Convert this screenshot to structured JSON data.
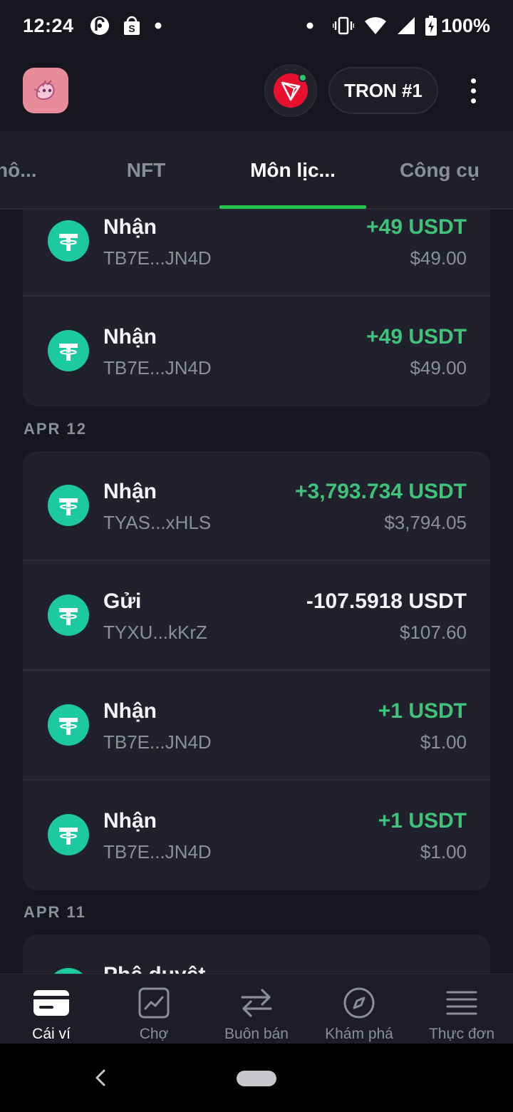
{
  "status_bar": {
    "time": "12:24",
    "battery": "100%",
    "icons": [
      "pocket-casts-icon",
      "shopping-bag-icon",
      "notification-dot-icon",
      "dot-icon",
      "vibrate-icon",
      "wifi-icon",
      "signal-icon",
      "battery-charging-icon"
    ]
  },
  "header": {
    "avatar_icon": "account-avatar-icon",
    "network_icon": "tron-logo-icon",
    "account_label": "TRON #1",
    "more_icon": "more-vertical-icon"
  },
  "tabs": [
    {
      "label": "hô...",
      "active": false
    },
    {
      "label": "NFT",
      "active": false
    },
    {
      "label": "Môn lịc...",
      "active": true
    },
    {
      "label": "Công cụ",
      "active": false
    }
  ],
  "groups": [
    {
      "date": "",
      "transactions": [
        {
          "type": "Nhận",
          "address": "TB7E...JN4D",
          "amount": "+49 USDT",
          "fiat": "$49.00",
          "direction": "in"
        },
        {
          "type": "Nhận",
          "address": "TB7E...JN4D",
          "amount": "+49 USDT",
          "fiat": "$49.00",
          "direction": "in"
        }
      ]
    },
    {
      "date": "APR 12",
      "transactions": [
        {
          "type": "Nhận",
          "address": "TYAS...xHLS",
          "amount": "+3,793.734 USDT",
          "fiat": "$3,794.05",
          "direction": "in"
        },
        {
          "type": "Gửi",
          "address": "TYXU...kKrZ",
          "amount": "-107.5918 USDT",
          "fiat": "$107.60",
          "direction": "out"
        },
        {
          "type": "Nhận",
          "address": "TB7E...JN4D",
          "amount": "+1 USDT",
          "fiat": "$1.00",
          "direction": "in"
        },
        {
          "type": "Nhận",
          "address": "TB7E...JN4D",
          "amount": "+1 USDT",
          "fiat": "$1.00",
          "direction": "in"
        }
      ]
    },
    {
      "date": "APR 11",
      "transactions": [
        {
          "type": "Phê duyệt",
          "address": "",
          "amount": "",
          "fiat": "",
          "direction": "approve"
        }
      ]
    }
  ],
  "coin_icon": "tether-usdt-icon",
  "colors": {
    "background": "#15161e",
    "card": "#20212c",
    "accent_green": "#25c24f",
    "positive_amount": "#3fc27a",
    "tether": "#1cc9a0",
    "tron_red": "#e8112d"
  },
  "bottom_nav": [
    {
      "label": "Cái ví",
      "icon": "wallet-icon",
      "active": true
    },
    {
      "label": "Chợ",
      "icon": "market-chart-icon",
      "active": false
    },
    {
      "label": "Buôn bán",
      "icon": "swap-arrows-icon",
      "active": false
    },
    {
      "label": "Khám phá",
      "icon": "compass-icon",
      "active": false
    },
    {
      "label": "Thực đơn",
      "icon": "menu-icon",
      "active": false
    }
  ],
  "system_nav": {
    "back_icon": "back-chevron-icon",
    "home_icon": "home-pill-icon"
  }
}
